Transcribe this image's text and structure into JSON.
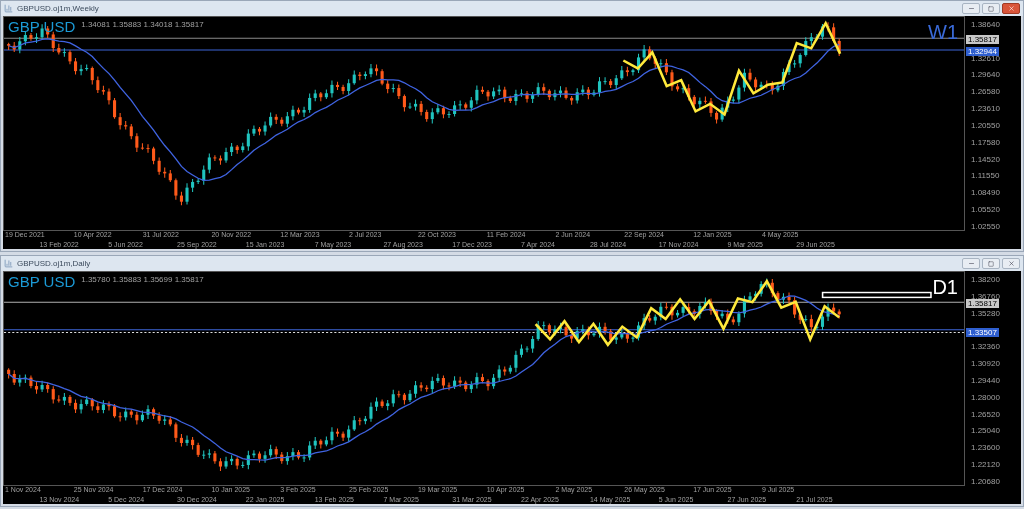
{
  "windows": [
    {
      "title": "GBPUSD.oj1m,Weekly",
      "active": true,
      "symbol_label": "GBP USD",
      "timeframe_label": "W1",
      "ohlc": "1.34081 1.35883 1.34018 1.35817",
      "price_ticks": [
        "1.38640",
        "1.32610",
        "1.29640",
        "1.26580",
        "1.23610",
        "1.20550",
        "1.17580",
        "1.14520",
        "1.11550",
        "1.08490",
        "1.05520",
        "1.02550"
      ],
      "price_tags": [
        {
          "text": "1.35817",
          "kind": "bid"
        },
        {
          "text": "1.32944",
          "kind": "line"
        }
      ],
      "date_ticks": [
        "19 Dec 2021",
        "13 Feb 2022",
        "10 Apr 2022",
        "5 Jun 2022",
        "31 Jul 2022",
        "25 Sep 2022",
        "20 Nov 2022",
        "15 Jan 2023",
        "12 Mar 2023",
        "7 May 2023",
        "2 Jul 2023",
        "27 Aug 2023",
        "22 Oct 2023",
        "17 Dec 2023",
        "11 Feb 2024",
        "7 Apr 2024",
        "2 Jun 2024",
        "28 Jul 2024",
        "22 Sep 2024",
        "17 Nov 2024",
        "12 Jan 2025",
        "9 Mar 2025",
        "4 May 2025",
        "29 Jun 2025"
      ]
    },
    {
      "title": "GBPUSD.oj1m,Daily",
      "active": false,
      "symbol_label": "GBP USD",
      "timeframe_label": "D1",
      "ohlc": "1.35780 1.35883 1.35699 1.35817",
      "price_ticks": [
        "1.38200",
        "1.36760",
        "1.35280",
        "1.32360",
        "1.30920",
        "1.29440",
        "1.28000",
        "1.26520",
        "1.25040",
        "1.23600",
        "1.22120",
        "1.20680"
      ],
      "price_tags": [
        {
          "text": "1.35817",
          "kind": "bid"
        },
        {
          "text": "1.33507",
          "kind": "line"
        }
      ],
      "date_ticks": [
        "1 Nov 2024",
        "13 Nov 2024",
        "25 Nov 2024",
        "5 Dec 2024",
        "17 Dec 2024",
        "30 Dec 2024",
        "10 Jan 2025",
        "22 Jan 2025",
        "3 Feb 2025",
        "13 Feb 2025",
        "25 Feb 2025",
        "7 Mar 2025",
        "19 Mar 2025",
        "31 Mar 2025",
        "10 Apr 2025",
        "22 Apr 2025",
        "2 May 2025",
        "14 May 2025",
        "26 May 2025",
        "5 Jun 2025",
        "17 Jun 2025",
        "27 Jun 2025",
        "9 Jul 2025",
        "21 Jul 2025"
      ]
    }
  ]
}
